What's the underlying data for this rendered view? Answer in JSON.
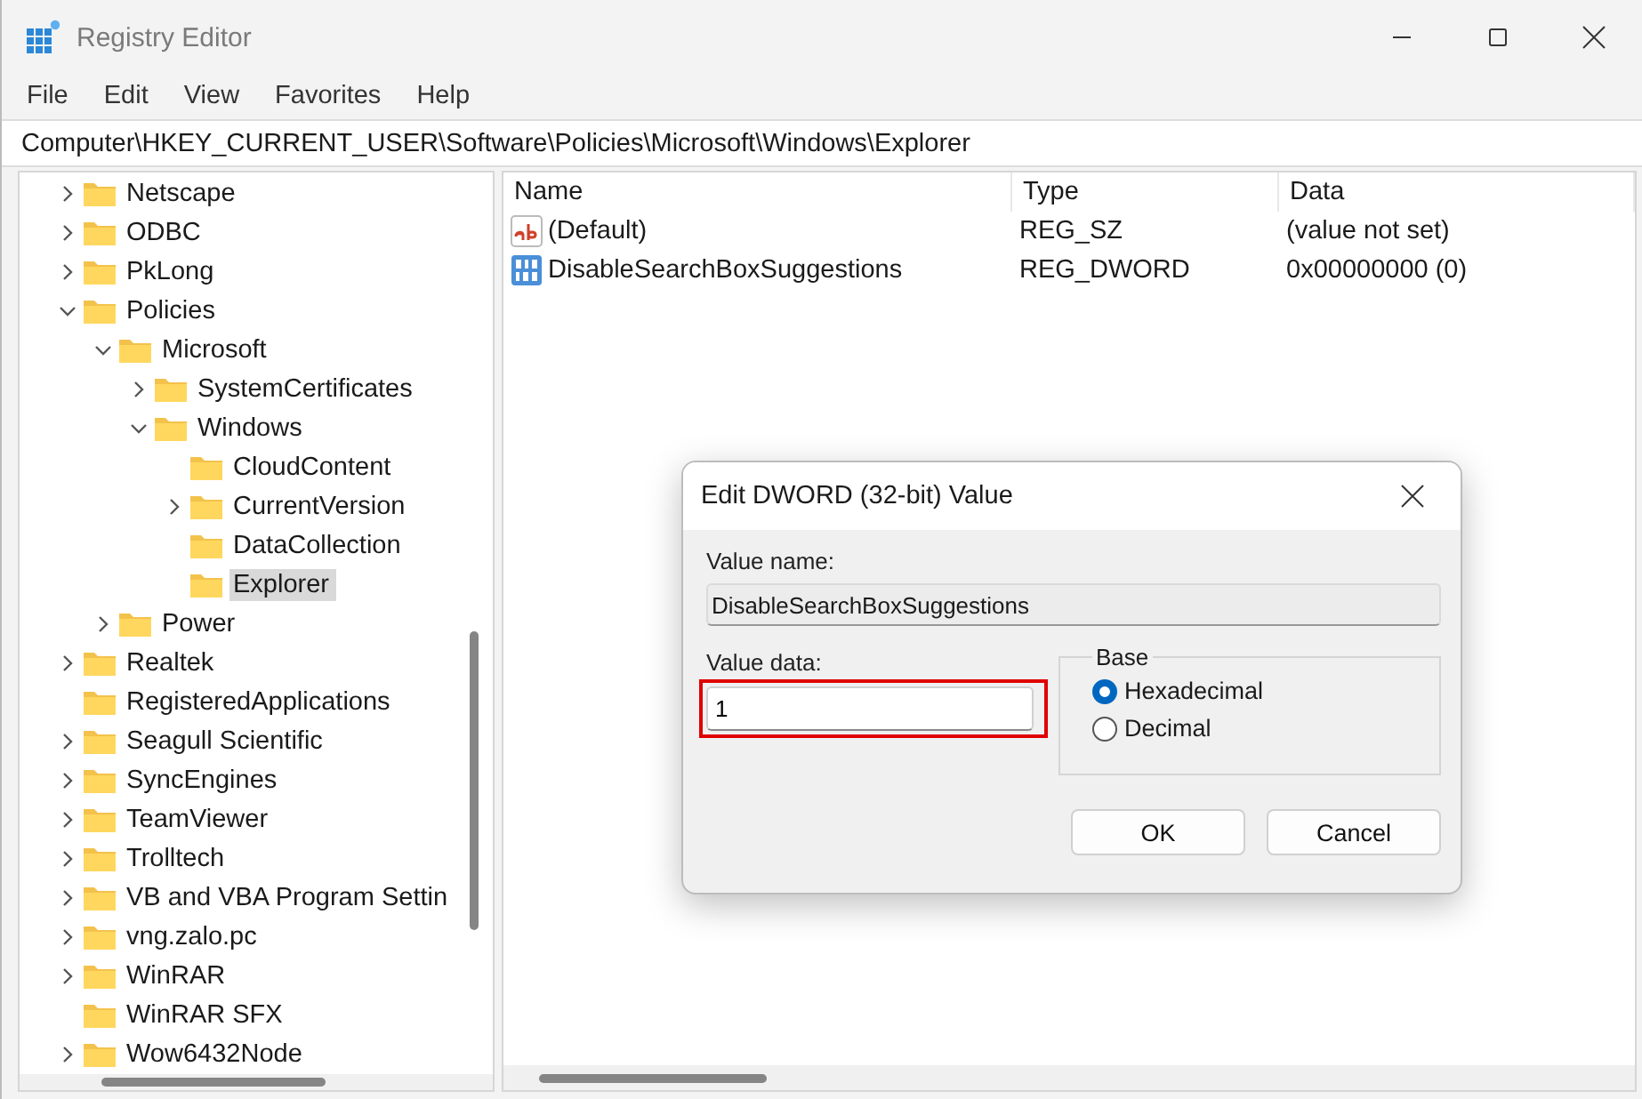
{
  "window": {
    "title": "Registry Editor"
  },
  "menu": [
    "File",
    "Edit",
    "View",
    "Favorites",
    "Help"
  ],
  "address": "Computer\\HKEY_CURRENT_USER\\Software\\Policies\\Microsoft\\Windows\\Explorer",
  "tree": [
    {
      "label": "Netscape",
      "expandable": true,
      "expanded": false,
      "selected": false
    },
    {
      "label": "ODBC",
      "expandable": true,
      "expanded": false,
      "selected": false
    },
    {
      "label": "PkLong",
      "expandable": true,
      "expanded": false,
      "selected": false
    },
    {
      "label": "Policies",
      "expandable": true,
      "expanded": true,
      "selected": false,
      "children": [
        {
          "label": "Microsoft",
          "expandable": true,
          "expanded": true,
          "selected": false,
          "children": [
            {
              "label": "SystemCertificates",
              "expandable": true,
              "expanded": false,
              "selected": false
            },
            {
              "label": "Windows",
              "expandable": true,
              "expanded": true,
              "selected": false,
              "children": [
                {
                  "label": "CloudContent",
                  "expandable": false,
                  "expanded": false,
                  "selected": false
                },
                {
                  "label": "CurrentVersion",
                  "expandable": true,
                  "expanded": false,
                  "selected": false
                },
                {
                  "label": "DataCollection",
                  "expandable": false,
                  "expanded": false,
                  "selected": false
                },
                {
                  "label": "Explorer",
                  "expandable": false,
                  "expanded": false,
                  "selected": true
                }
              ]
            }
          ]
        },
        {
          "label": "Power",
          "expandable": true,
          "expanded": false,
          "selected": false
        }
      ]
    },
    {
      "label": "Realtek",
      "expandable": true,
      "expanded": false,
      "selected": false
    },
    {
      "label": "RegisteredApplications",
      "expandable": false,
      "expanded": false,
      "selected": false
    },
    {
      "label": "Seagull Scientific",
      "expandable": true,
      "expanded": false,
      "selected": false
    },
    {
      "label": "SyncEngines",
      "expandable": true,
      "expanded": false,
      "selected": false
    },
    {
      "label": "TeamViewer",
      "expandable": true,
      "expanded": false,
      "selected": false
    },
    {
      "label": "Trolltech",
      "expandable": true,
      "expanded": false,
      "selected": false
    },
    {
      "label": "VB and VBA Program Settin",
      "expandable": true,
      "expanded": false,
      "selected": false
    },
    {
      "label": "vng.zalo.pc",
      "expandable": true,
      "expanded": false,
      "selected": false
    },
    {
      "label": "WinRAR",
      "expandable": true,
      "expanded": false,
      "selected": false
    },
    {
      "label": "WinRAR SFX",
      "expandable": false,
      "expanded": false,
      "selected": false
    },
    {
      "label": "Wow6432Node",
      "expandable": true,
      "expanded": false,
      "selected": false
    }
  ],
  "values": {
    "columns": [
      "Name",
      "Type",
      "Data"
    ],
    "rows": [
      {
        "kind": "string",
        "name": "(Default)",
        "type": "REG_SZ",
        "data": "(value not set)",
        "selected": false
      },
      {
        "kind": "dword",
        "name": "DisableSearchBoxSuggestions",
        "type": "REG_DWORD",
        "data": "0x00000000 (0)",
        "selected": false
      }
    ]
  },
  "dialog": {
    "title": "Edit DWORD (32-bit) Value",
    "value_name_label": "Value name:",
    "value_name": "DisableSearchBoxSuggestions",
    "value_data_label": "Value data:",
    "value_data": "1",
    "highlighted": true,
    "base_label": "Base",
    "base_options": [
      {
        "label": "Hexadecimal",
        "selected": true
      },
      {
        "label": "Decimal",
        "selected": false
      }
    ],
    "buttons": [
      "OK",
      "Cancel"
    ]
  }
}
